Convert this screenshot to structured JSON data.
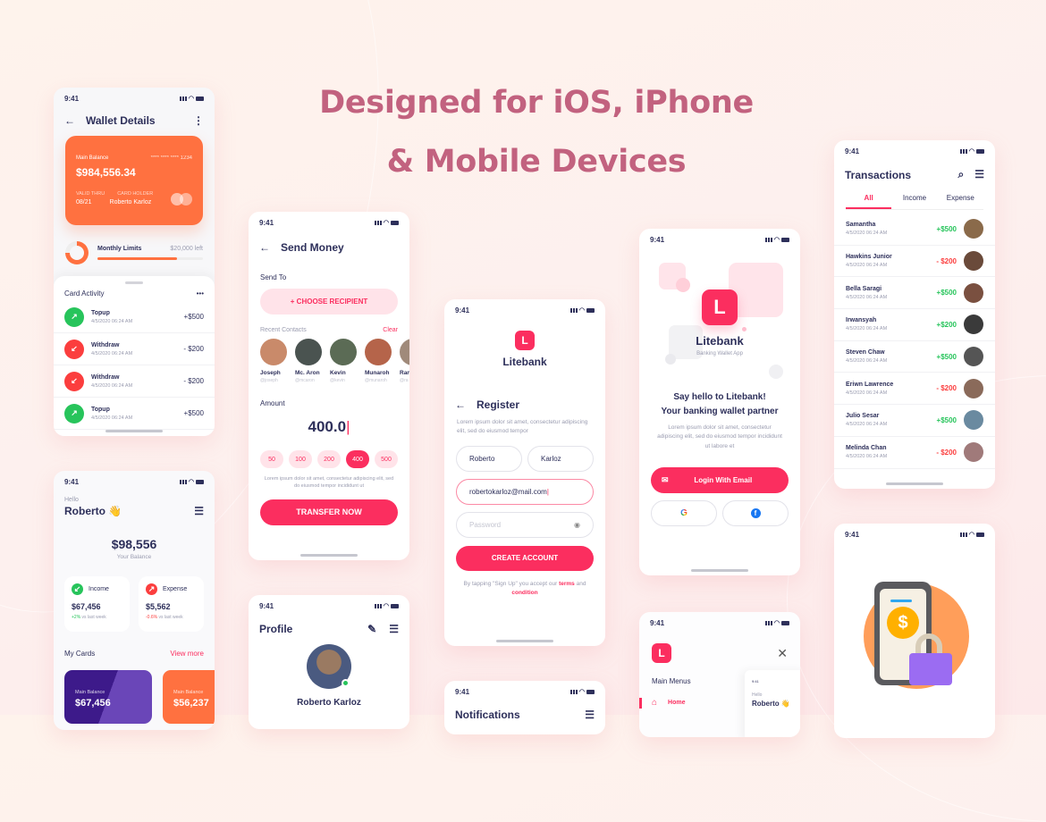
{
  "hero": {
    "line1": "Designed for iOS, iPhone",
    "line2": "& Mobile Devices"
  },
  "status_time": "9:41",
  "wallet": {
    "title": "Wallet Details",
    "card": {
      "label": "Main Balance",
      "number": "**** **** **** 1234",
      "balance": "$984,556.34",
      "valid_label": "VALID THRU",
      "valid": "08/21",
      "holder_label": "CARD HOLDER",
      "holder": "Roberto Karloz"
    },
    "limits": {
      "label": "Monthly Limits",
      "left": "$20,000 left",
      "progress": 0.75
    },
    "activity_title": "Card Activity",
    "activity": [
      {
        "type": "in",
        "title": "Topup",
        "date": "4/5/2020 06:24 AM",
        "amount": "+$500"
      },
      {
        "type": "out",
        "title": "Withdraw",
        "date": "4/5/2020 06:24 AM",
        "amount": "- $200"
      },
      {
        "type": "out",
        "title": "Withdraw",
        "date": "4/5/2020 06:24 AM",
        "amount": "- $200"
      },
      {
        "type": "in",
        "title": "Topup",
        "date": "4/5/2020 06:24 AM",
        "amount": "+$500"
      }
    ]
  },
  "home": {
    "greeting": "Hello",
    "name": "Roberto 👋",
    "balance": "$98,556",
    "balance_label": "Your Balance",
    "income": {
      "label": "Income",
      "value": "$67,456",
      "change": "+2%",
      "suffix": " vs last week"
    },
    "expense": {
      "label": "Expense",
      "value": "$5,562",
      "change": "-0.6%",
      "suffix": " vs last week"
    },
    "cards_title": "My Cards",
    "view_more": "View more",
    "cards": [
      {
        "label": "Main Balance",
        "value": "$67,456"
      },
      {
        "label": "Main Balance",
        "value": "$56,237"
      }
    ]
  },
  "send": {
    "title": "Send Money",
    "send_to": "Send To",
    "choose": "+ CHOOSE RECIPIENT",
    "recent": "Recent Contacts",
    "clear": "Clear",
    "contacts": [
      {
        "name": "Joseph",
        "handle": "@joseph",
        "color": "#c98a6a"
      },
      {
        "name": "Mc. Aron",
        "handle": "@mcaron",
        "color": "#4a5350"
      },
      {
        "name": "Kevin",
        "handle": "@kevin",
        "color": "#5b6b55"
      },
      {
        "name": "Munaroh",
        "handle": "@munaroh",
        "color": "#b5644a"
      },
      {
        "name": "Ran",
        "handle": "@ra",
        "color": "#a08a7a"
      }
    ],
    "amount_label": "Amount",
    "amount": "400.0",
    "chips": [
      "50",
      "100",
      "200",
      "400",
      "500"
    ],
    "selected_chip": "400",
    "note": "Lorem ipsum dolor sit amet, consectetur adipiscing elit, sed do eiusmod tempor incididunt ut",
    "transfer": "TRANSFER NOW"
  },
  "profile": {
    "title": "Profile",
    "name": "Roberto Karloz"
  },
  "register": {
    "brand": "Litebank",
    "logo": "L",
    "title": "Register",
    "desc": "Lorem ipsum dolor sit amet, consectetur adipiscing elit, sed do eiusmod tempor",
    "first": "Roberto",
    "last": "Karloz",
    "email": "robertokarloz@mail.com",
    "password_placeholder": "Password",
    "create": "CREATE ACCOUNT",
    "terms_pre": "By tapping \"Sign Up\" you accept our ",
    "terms": "terms",
    "and": " and",
    "condition": "condition"
  },
  "notifications": {
    "title": "Notifications"
  },
  "welcome": {
    "logo": "L",
    "brand": "Litebank",
    "tagline": "Banking Wallet App",
    "headline1": "Say hello to Litebank!",
    "headline2": "Your banking wallet partner",
    "desc": "Lorem ipsum dolor sit amet, consectetur adipiscing elit, sed do eiusmod tempor incididunt ut labore et",
    "login_email": "Login With Email"
  },
  "menu": {
    "logo": "L",
    "title": "Main Menus",
    "home": "Home",
    "preview_hello": "Hello",
    "preview_name": "Roberto 👋"
  },
  "transactions": {
    "title": "Transactions",
    "tabs": [
      "All",
      "Income",
      "Expense"
    ],
    "active_tab": "All",
    "items": [
      {
        "name": "Samantha",
        "date": "4/5/2020 06:24 AM",
        "amount": "+$500",
        "type": "in",
        "color": "#8a6a4a"
      },
      {
        "name": "Hawkins Junior",
        "date": "4/5/2020 06:24 AM",
        "amount": "- $200",
        "type": "out",
        "color": "#6a4a3a"
      },
      {
        "name": "Bella Saragi",
        "date": "4/5/2020 06:24 AM",
        "amount": "+$500",
        "type": "in",
        "color": "#7a5040"
      },
      {
        "name": "Irwansyah",
        "date": "4/5/2020 06:24 AM",
        "amount": "+$200",
        "type": "in",
        "color": "#3a3a3a"
      },
      {
        "name": "Steven Chaw",
        "date": "4/5/2020 06:24 AM",
        "amount": "+$500",
        "type": "in",
        "color": "#555"
      },
      {
        "name": "Eriwn Lawrence",
        "date": "4/5/2020 06:24 AM",
        "amount": "- $200",
        "type": "out",
        "color": "#8a6a5a"
      },
      {
        "name": "Julio Sesar",
        "date": "4/5/2020 06:24 AM",
        "amount": "+$500",
        "type": "in",
        "color": "#6a8aa0"
      },
      {
        "name": "Melinda Chan",
        "date": "4/5/2020 06:24 AM",
        "amount": "- $200",
        "type": "out",
        "color": "#a07a7a"
      }
    ]
  }
}
